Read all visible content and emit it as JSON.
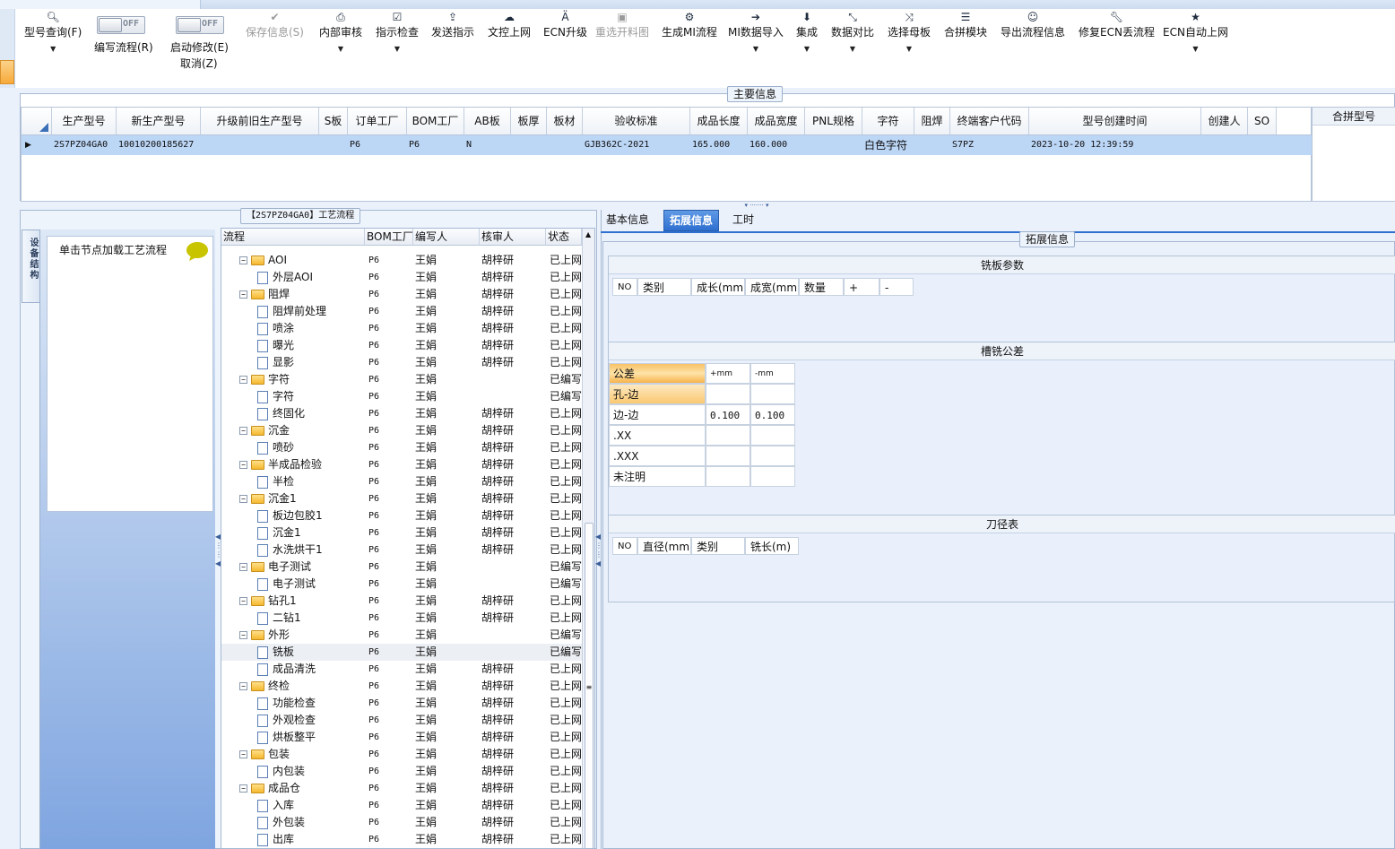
{
  "toolbar": {
    "items": [
      {
        "icon": "search-icon",
        "label": "型号查询(F)",
        "dropdown": true,
        "disabled": false
      },
      {
        "icon": "save-icon",
        "label": "保存信息(S)",
        "dropdown": false,
        "disabled": true
      },
      {
        "icon": "print-icon",
        "label": "内部审核",
        "dropdown": true,
        "disabled": false
      },
      {
        "icon": "check-icon",
        "label": "指示检查",
        "dropdown": true,
        "disabled": false
      },
      {
        "icon": "upload-icon",
        "label": "发送指示",
        "dropdown": false,
        "disabled": false
      },
      {
        "icon": "cloud-upload-icon",
        "label": "文控上网",
        "dropdown": false,
        "disabled": false
      },
      {
        "icon": "ecn-icon",
        "label": "ECN升级",
        "dropdown": false,
        "disabled": false
      },
      {
        "icon": "image-icon",
        "label": "重选开料图",
        "dropdown": false,
        "disabled": true
      },
      {
        "icon": "cogs-icon",
        "label": "生成MI流程",
        "dropdown": false,
        "disabled": false
      },
      {
        "icon": "import-icon",
        "label": "MI数据导入",
        "dropdown": true,
        "disabled": false
      },
      {
        "icon": "download-icon",
        "label": "集成",
        "dropdown": true,
        "disabled": false
      },
      {
        "icon": "compress-icon",
        "label": "数据对比",
        "dropdown": true,
        "disabled": false
      },
      {
        "icon": "random-icon",
        "label": "选择母板",
        "dropdown": true,
        "disabled": false
      },
      {
        "icon": "list-icon",
        "label": "合拼模块",
        "dropdown": false,
        "disabled": false
      },
      {
        "icon": "smile-icon",
        "label": "导出流程信息",
        "dropdown": false,
        "disabled": false
      },
      {
        "icon": "wrench-icon",
        "label": "修复ECN丢流程",
        "dropdown": false,
        "disabled": false
      },
      {
        "icon": "star-icon",
        "label": "ECN自动上网",
        "dropdown": true,
        "disabled": false
      }
    ],
    "toggle1": {
      "state": "OFF",
      "label": "编写流程(R)"
    },
    "toggle2": {
      "state": "OFF",
      "label": "启动修改(E)",
      "label2": "取消(Z)"
    }
  },
  "main_info": {
    "title": "主要信息",
    "columns": [
      "生产型号",
      "新生产型号",
      "升级前旧生产型号",
      "S板",
      "订单工厂",
      "BOM工厂",
      "AB板",
      "板厚",
      "板材",
      "验收标准",
      "成品长度",
      "成品宽度",
      "PNL规格",
      "字符",
      "阻焊",
      "终端客户代码",
      "型号创建时间",
      "创建人",
      "SO"
    ],
    "row": [
      "2S7PZ04GA0",
      "10010200185627",
      "",
      "",
      "P6",
      "P6",
      "N",
      "",
      "",
      "GJB362C-2021",
      "165.000",
      "160.000",
      "",
      "白色字符",
      "",
      "S7PZ",
      "2023-10-20 12:39:59",
      "",
      ""
    ],
    "merge_title": "合拼型号"
  },
  "process": {
    "title": "【2S7PZ04GA0】工艺流程",
    "vtab": "设备结构",
    "node_hint": "单击节点加载工艺流程",
    "columns": [
      "流程",
      "BOM工厂",
      "编写人",
      "核审人",
      "状态"
    ],
    "rows": [
      {
        "level": 1,
        "type": "folder",
        "name": "AOI",
        "factory": "P6",
        "writer": "王娟",
        "reviewer": "胡梓研",
        "status": "已上网"
      },
      {
        "level": 2,
        "type": "doc",
        "name": "外层AOI",
        "factory": "P6",
        "writer": "王娟",
        "reviewer": "胡梓研",
        "status": "已上网"
      },
      {
        "level": 1,
        "type": "folder",
        "name": "阻焊",
        "factory": "P6",
        "writer": "王娟",
        "reviewer": "胡梓研",
        "status": "已上网"
      },
      {
        "level": 2,
        "type": "doc",
        "name": "阻焊前处理",
        "factory": "P6",
        "writer": "王娟",
        "reviewer": "胡梓研",
        "status": "已上网"
      },
      {
        "level": 2,
        "type": "doc",
        "name": "喷涂",
        "factory": "P6",
        "writer": "王娟",
        "reviewer": "胡梓研",
        "status": "已上网"
      },
      {
        "level": 2,
        "type": "doc",
        "name": "曝光",
        "factory": "P6",
        "writer": "王娟",
        "reviewer": "胡梓研",
        "status": "已上网"
      },
      {
        "level": 2,
        "type": "doc",
        "name": "显影",
        "factory": "P6",
        "writer": "王娟",
        "reviewer": "胡梓研",
        "status": "已上网"
      },
      {
        "level": 1,
        "type": "folder",
        "name": "字符",
        "factory": "P6",
        "writer": "王娟",
        "reviewer": "",
        "status": "已编写"
      },
      {
        "level": 2,
        "type": "doc",
        "name": "字符",
        "factory": "P6",
        "writer": "王娟",
        "reviewer": "",
        "status": "已编写"
      },
      {
        "level": 2,
        "type": "doc",
        "name": "终固化",
        "factory": "P6",
        "writer": "王娟",
        "reviewer": "胡梓研",
        "status": "已上网"
      },
      {
        "level": 1,
        "type": "folder",
        "name": "沉金",
        "factory": "P6",
        "writer": "王娟",
        "reviewer": "胡梓研",
        "status": "已上网"
      },
      {
        "level": 2,
        "type": "doc",
        "name": "喷砂",
        "factory": "P6",
        "writer": "王娟",
        "reviewer": "胡梓研",
        "status": "已上网"
      },
      {
        "level": 1,
        "type": "folder",
        "name": "半成品检验",
        "factory": "P6",
        "writer": "王娟",
        "reviewer": "胡梓研",
        "status": "已上网"
      },
      {
        "level": 2,
        "type": "doc",
        "name": "半检",
        "factory": "P6",
        "writer": "王娟",
        "reviewer": "胡梓研",
        "status": "已上网"
      },
      {
        "level": 1,
        "type": "folder",
        "name": "沉金1",
        "factory": "P6",
        "writer": "王娟",
        "reviewer": "胡梓研",
        "status": "已上网"
      },
      {
        "level": 2,
        "type": "doc",
        "name": "板边包胶1",
        "factory": "P6",
        "writer": "王娟",
        "reviewer": "胡梓研",
        "status": "已上网"
      },
      {
        "level": 2,
        "type": "doc",
        "name": "沉金1",
        "factory": "P6",
        "writer": "王娟",
        "reviewer": "胡梓研",
        "status": "已上网"
      },
      {
        "level": 2,
        "type": "doc",
        "name": "水洗烘干1",
        "factory": "P6",
        "writer": "王娟",
        "reviewer": "胡梓研",
        "status": "已上网"
      },
      {
        "level": 1,
        "type": "folder",
        "name": "电子测试",
        "factory": "P6",
        "writer": "王娟",
        "reviewer": "",
        "status": "已编写"
      },
      {
        "level": 2,
        "type": "doc",
        "name": "电子测试",
        "factory": "P6",
        "writer": "王娟",
        "reviewer": "",
        "status": "已编写"
      },
      {
        "level": 1,
        "type": "folder",
        "name": "钻孔1",
        "factory": "P6",
        "writer": "王娟",
        "reviewer": "胡梓研",
        "status": "已上网"
      },
      {
        "level": 2,
        "type": "doc",
        "name": "二钻1",
        "factory": "P6",
        "writer": "王娟",
        "reviewer": "胡梓研",
        "status": "已上网"
      },
      {
        "level": 1,
        "type": "folder",
        "name": "外形",
        "factory": "P6",
        "writer": "王娟",
        "reviewer": "",
        "status": "已编写"
      },
      {
        "level": 2,
        "type": "doc",
        "name": "铣板",
        "factory": "P6",
        "writer": "王娟",
        "reviewer": "",
        "status": "已编写",
        "selected": true
      },
      {
        "level": 2,
        "type": "doc",
        "name": "成品清洗",
        "factory": "P6",
        "writer": "王娟",
        "reviewer": "胡梓研",
        "status": "已上网"
      },
      {
        "level": 1,
        "type": "folder",
        "name": "终检",
        "factory": "P6",
        "writer": "王娟",
        "reviewer": "胡梓研",
        "status": "已上网"
      },
      {
        "level": 2,
        "type": "doc",
        "name": "功能检查",
        "factory": "P6",
        "writer": "王娟",
        "reviewer": "胡梓研",
        "status": "已上网"
      },
      {
        "level": 2,
        "type": "doc",
        "name": "外观检查",
        "factory": "P6",
        "writer": "王娟",
        "reviewer": "胡梓研",
        "status": "已上网"
      },
      {
        "level": 2,
        "type": "doc",
        "name": "烘板整平",
        "factory": "P6",
        "writer": "王娟",
        "reviewer": "胡梓研",
        "status": "已上网"
      },
      {
        "level": 1,
        "type": "folder",
        "name": "包装",
        "factory": "P6",
        "writer": "王娟",
        "reviewer": "胡梓研",
        "status": "已上网"
      },
      {
        "level": 2,
        "type": "doc",
        "name": "内包装",
        "factory": "P6",
        "writer": "王娟",
        "reviewer": "胡梓研",
        "status": "已上网"
      },
      {
        "level": 1,
        "type": "folder",
        "name": "成品仓",
        "factory": "P6",
        "writer": "王娟",
        "reviewer": "胡梓研",
        "status": "已上网"
      },
      {
        "level": 2,
        "type": "doc",
        "name": "入库",
        "factory": "P6",
        "writer": "王娟",
        "reviewer": "胡梓研",
        "status": "已上网"
      },
      {
        "level": 2,
        "type": "doc",
        "name": "外包装",
        "factory": "P6",
        "writer": "王娟",
        "reviewer": "胡梓研",
        "status": "已上网"
      },
      {
        "level": 2,
        "type": "doc",
        "name": "出库",
        "factory": "P6",
        "writer": "王娟",
        "reviewer": "胡梓研",
        "status": "已上网"
      }
    ]
  },
  "detail": {
    "tabs": [
      "基本信息",
      "拓展信息",
      "工时"
    ],
    "active_tab": "拓展信息",
    "group_title": "拓展信息",
    "mill_params": {
      "title": "铣板参数",
      "columns": [
        "NO",
        "类别",
        "成长(mm)",
        "成宽(mm)",
        "数量",
        "+",
        "-"
      ]
    },
    "routing_tol": {
      "title": "槽铣公差",
      "header": [
        "公差",
        "+mm",
        "-mm"
      ],
      "rows": [
        [
          "孔-边",
          "",
          ""
        ],
        [
          "边-边",
          "0.100",
          "0.100"
        ],
        [
          ".XX",
          "",
          ""
        ],
        [
          ".XXX",
          "",
          ""
        ],
        [
          "未注明",
          "",
          ""
        ]
      ]
    },
    "tool_table": {
      "title": "刀径表",
      "columns": [
        "NO",
        "直径(mm)",
        "类别",
        "铣长(m)"
      ]
    }
  },
  "colors": {
    "accent": "#2f6fcf",
    "selected_row": "#bcd6f6",
    "highlight": "#f9c266"
  }
}
